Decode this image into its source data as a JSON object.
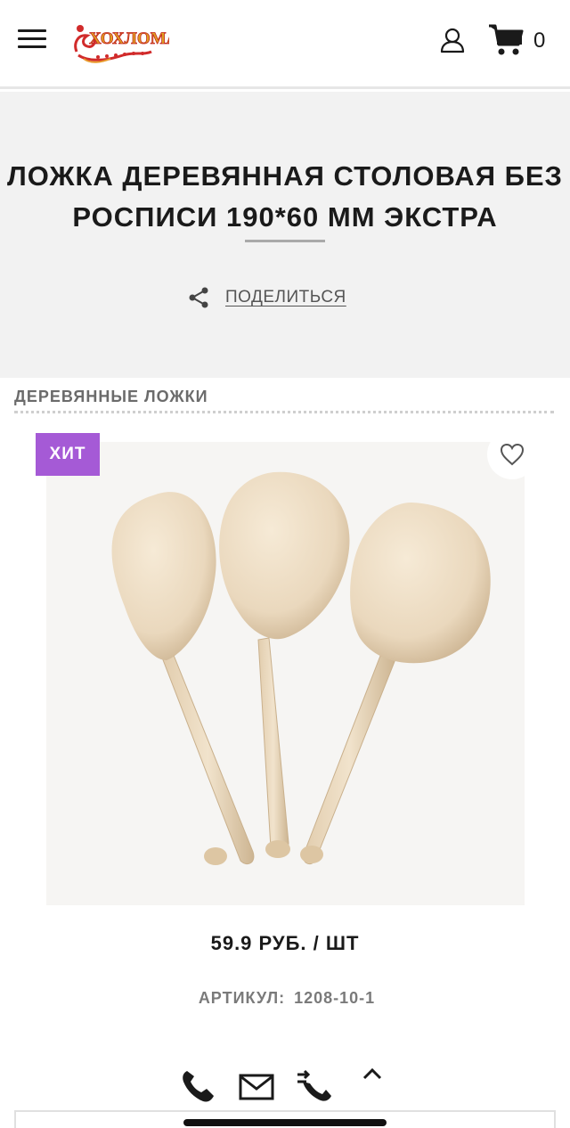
{
  "header": {
    "logo_text": "ХОХЛОМА",
    "cart_count": "0",
    "menu_icon": "hamburger-menu-icon",
    "user_icon": "user-icon",
    "cart_icon": "cart-icon"
  },
  "product": {
    "title_line1": "ЛОЖКА ДЕРЕВЯННАЯ СТОЛОВАЯ БЕЗ",
    "title_line2": "РОСПИСИ 190*60 ММ ЭКСТРА",
    "share_label": "ПОДЕЛИТЬСЯ",
    "category": "ДЕРЕВЯННЫЕ ЛОЖКИ",
    "badge": "ХИТ",
    "price": "59.9 РУБ. / ШТ",
    "sku_label": "АРТИКУЛ:",
    "sku_value": "1208-10-1"
  },
  "colors": {
    "accent_badge": "#a55ad6",
    "title_band": "#f2f2f2",
    "text": "#1a1a1a",
    "muted": "#7a7a7a"
  },
  "bottom_bar": {
    "icons": [
      "phone-icon",
      "mail-icon",
      "callback-icon",
      "scroll-up-icon"
    ]
  }
}
